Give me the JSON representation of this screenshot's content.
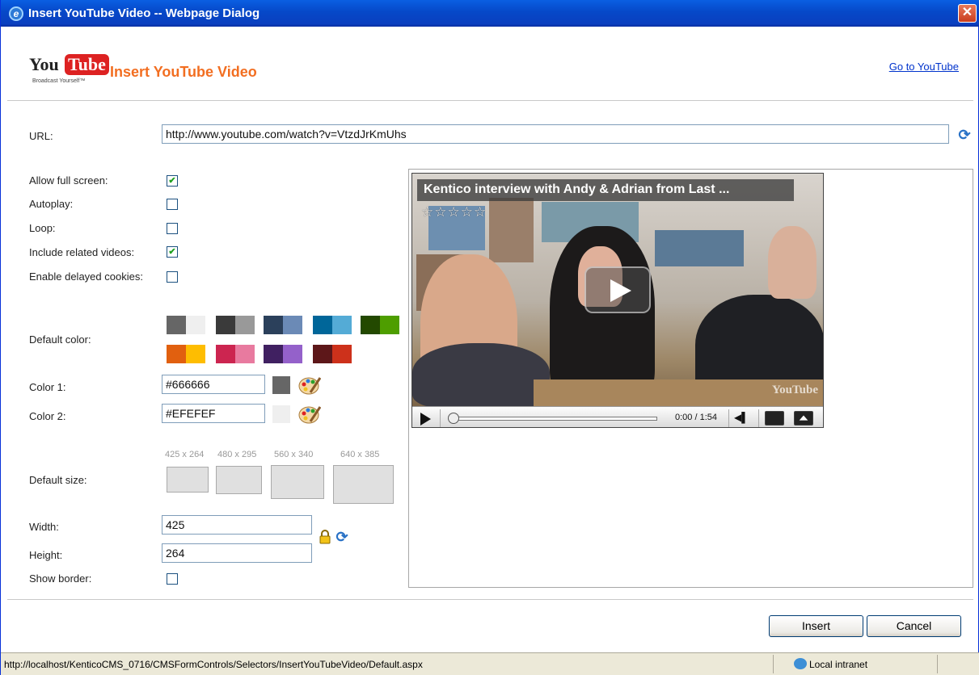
{
  "window": {
    "title": "Insert YouTube Video -- Webpage Dialog",
    "close_glyph": "✕"
  },
  "header": {
    "logo_you": "You",
    "logo_tube": "Tube",
    "logo_slogan": "Broadcast Yourself™",
    "heading": "Insert YouTube Video",
    "goto_link": "Go to YouTube"
  },
  "url": {
    "label": "URL:",
    "value": "http://www.youtube.com/watch?v=VtzdJrKmUhs"
  },
  "options": [
    {
      "label": "Allow full screen:",
      "checked": true
    },
    {
      "label": "Autoplay:",
      "checked": false
    },
    {
      "label": "Loop:",
      "checked": false
    },
    {
      "label": "Include related videos:",
      "checked": true
    },
    {
      "label": "Enable delayed cookies:",
      "checked": false
    }
  ],
  "colors": {
    "default_label": "Default color:",
    "palette": [
      [
        "#666666",
        "#efefef"
      ],
      [
        "#3a3a3a",
        "#999999"
      ],
      [
        "#2b405b",
        "#6b8ab6"
      ],
      [
        "#006699",
        "#54abd6"
      ],
      [
        "#234900",
        "#4e9e00"
      ],
      [
        "#e1600f",
        "#febd01"
      ],
      [
        "#cc2550",
        "#e87a9f"
      ],
      [
        "#402061",
        "#9461ca"
      ],
      [
        "#5d1719",
        "#cd311b"
      ]
    ],
    "color1_label": "Color 1:",
    "color1_value": "#666666",
    "color2_label": "Color 2:",
    "color2_value": "#EFEFEF"
  },
  "size": {
    "default_label": "Default size:",
    "presets": [
      "425 x 264",
      "480 x 295",
      "560 x 340",
      "640 x 385"
    ],
    "width_label": "Width:",
    "width_value": "425",
    "height_label": "Height:",
    "height_value": "264",
    "border_label": "Show border:",
    "border_checked": false
  },
  "video": {
    "title": "Kentico interview with Andy & Adrian from Last ...",
    "stars": "☆☆☆☆☆",
    "watermark": "YouTube",
    "time": "0:00 / 1:54",
    "volume_glyph": "◀▌"
  },
  "buttons": {
    "insert": "Insert",
    "cancel": "Cancel"
  },
  "statusbar": {
    "url": "http://localhost/KenticoCMS_0716/CMSFormControls/Selectors/InsertYouTubeVideo/Default.aspx",
    "zone": "Local intranet"
  }
}
